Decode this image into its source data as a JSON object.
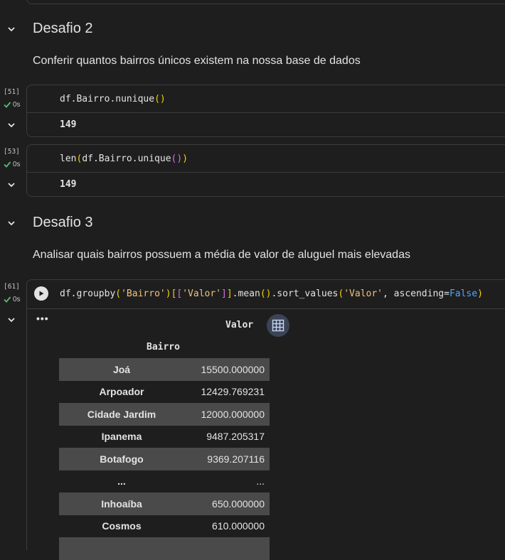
{
  "sections": [
    {
      "heading": "Desafio 2",
      "description": "Conferir quantos bairros únicos existem na nossa base de dados"
    },
    {
      "heading": "Desafio 3",
      "description": "Analisar quais bairros possuem a média de valor de aluguel mais elevadas"
    }
  ],
  "cells": [
    {
      "exec_count": "[51]",
      "time": "0s",
      "code": "df.Bairro.nunique()",
      "output": "149"
    },
    {
      "exec_count": "[53]",
      "time": "0s",
      "code": "len(df.Bairro.unique())",
      "output": "149"
    },
    {
      "exec_count": "[61]",
      "time": "0s",
      "code": "df.groupby('Bairro')[['Valor']].mean().sort_values('Valor', ascending=False)",
      "output_menu": "•••",
      "table": {
        "column_header": "Valor",
        "index_name": "Bairro",
        "rows": [
          {
            "bairro": "Joá",
            "valor": "15500.000000"
          },
          {
            "bairro": "Arpoador",
            "valor": "12429.769231"
          },
          {
            "bairro": "Cidade Jardim",
            "valor": "12000.000000"
          },
          {
            "bairro": "Ipanema",
            "valor": "9487.205317"
          },
          {
            "bairro": "Botafogo",
            "valor": "9369.207116"
          },
          {
            "bairro": "...",
            "valor": "..."
          },
          {
            "bairro": "Inhoaíba",
            "valor": "650.000000"
          },
          {
            "bairro": "Cosmos",
            "valor": "610.000000"
          },
          {
            "bairro": "",
            "valor": ""
          }
        ]
      }
    }
  ],
  "icons": {
    "collapse": "chevron-down-icon",
    "check": "check-icon",
    "run": "play-icon",
    "table_view": "table-icon"
  },
  "colors": {
    "background": "#1e1e1e",
    "check_green": "#5bb974",
    "table_shade": "#4a4a4a"
  }
}
